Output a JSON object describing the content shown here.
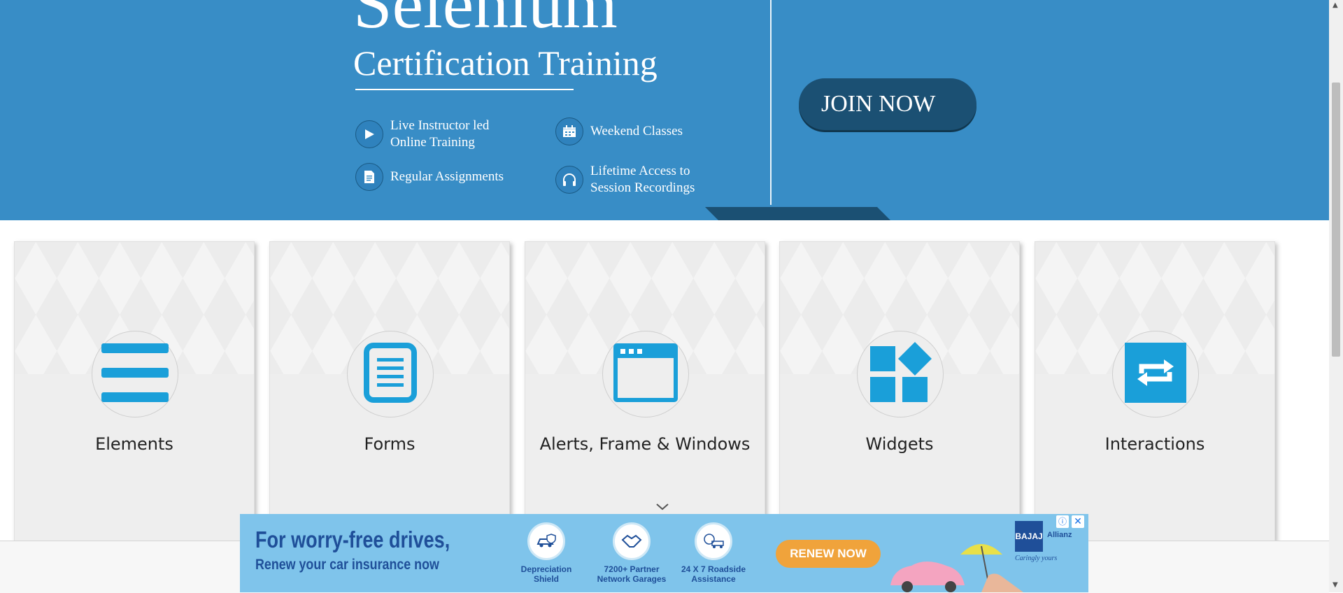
{
  "banner": {
    "title": "Selenium",
    "subtitle": "Certification Training",
    "features": [
      {
        "icon": "play-icon",
        "text": "Live Instructor led Online Training"
      },
      {
        "icon": "calendar-icon",
        "text": "Weekend Classes"
      },
      {
        "icon": "document-icon",
        "text": "Regular Assignments"
      },
      {
        "icon": "headphones-icon",
        "text": "Lifetime Access to Session Recordings"
      }
    ],
    "join_button": "JOIN NOW",
    "background_color": "#388dc6"
  },
  "cards": [
    {
      "title": "Elements",
      "icon": "hamburger-menu-icon"
    },
    {
      "title": "Forms",
      "icon": "form-document-icon"
    },
    {
      "title": "Alerts, Frame & Windows",
      "icon": "browser-window-icon"
    },
    {
      "title": "Widgets",
      "icon": "widgets-blocks-icon"
    },
    {
      "title": "Interactions",
      "icon": "swap-arrows-icon"
    }
  ],
  "accent_color": "#1a9fd9",
  "ad": {
    "headline": "For worry-free drives,",
    "subline": "Renew your car insurance now",
    "features": [
      {
        "line1": "Depreciation",
        "line2": "Shield"
      },
      {
        "line1": "7200+ Partner",
        "line2": "Network Garages"
      },
      {
        "line1": "24 X 7 Roadside",
        "line2": "Assistance"
      }
    ],
    "cta": "RENEW NOW",
    "brand_logo": "BAJAJ",
    "brand_name": "Allianz",
    "brand_tagline": "Caringly yours"
  }
}
